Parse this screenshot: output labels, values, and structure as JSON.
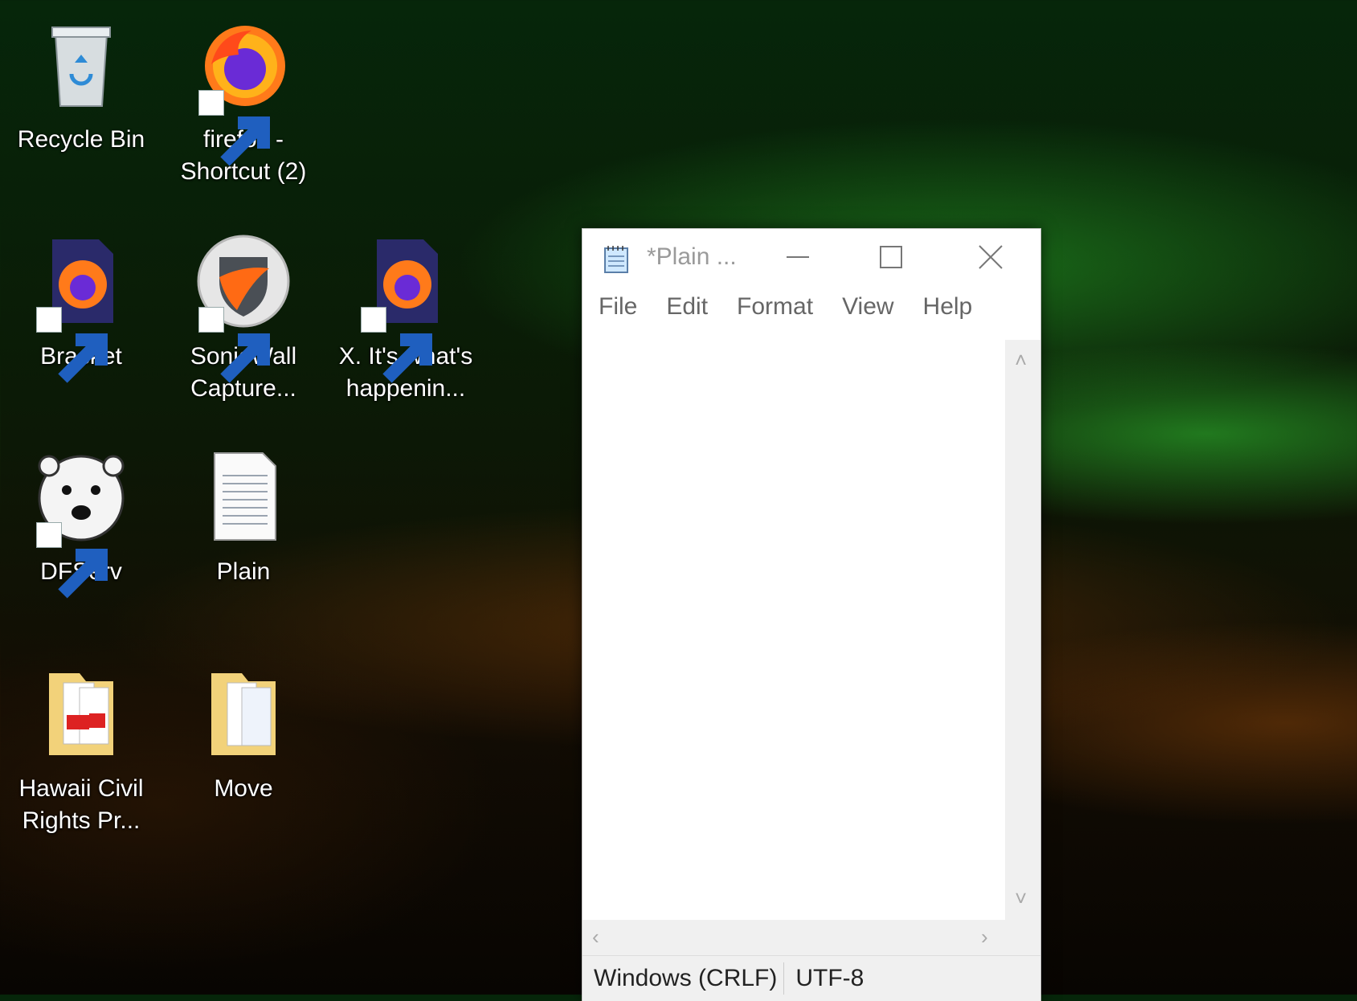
{
  "desktop": {
    "icons": [
      {
        "id": "recycle-bin",
        "label": "Recycle Bin",
        "icon": "recycle-bin-icon",
        "shortcut": false
      },
      {
        "id": "firefox",
        "label": "firefox -\nShortcut (2)",
        "icon": "firefox-icon",
        "shortcut": true
      },
      {
        "id": "bracket",
        "label": "Bracket",
        "icon": "firefox-file-icon",
        "shortcut": true
      },
      {
        "id": "sonicwall",
        "label": "SonicWall\nCapture...",
        "icon": "sonicwall-icon",
        "shortcut": true
      },
      {
        "id": "x-happening",
        "label": "X. It's what's\nhappenin...",
        "icon": "firefox-file-icon",
        "shortcut": true
      },
      {
        "id": "dfserv",
        "label": "DFServ",
        "icon": "polar-bear-icon",
        "shortcut": true
      },
      {
        "id": "plain",
        "label": "Plain",
        "icon": "text-document-icon",
        "shortcut": false
      },
      {
        "id": "hawaii",
        "label": "Hawaii Civil\nRights Pr...",
        "icon": "pdf-folder-icon",
        "shortcut": false
      },
      {
        "id": "move",
        "label": "Move",
        "icon": "folder-icon",
        "shortcut": false
      }
    ]
  },
  "notepad": {
    "title": "*Plain ...",
    "menu": [
      "File",
      "Edit",
      "Format",
      "View",
      "Help"
    ],
    "content": "",
    "status": {
      "line_ending": "Windows (CRLF)",
      "encoding": "UTF-8"
    }
  }
}
